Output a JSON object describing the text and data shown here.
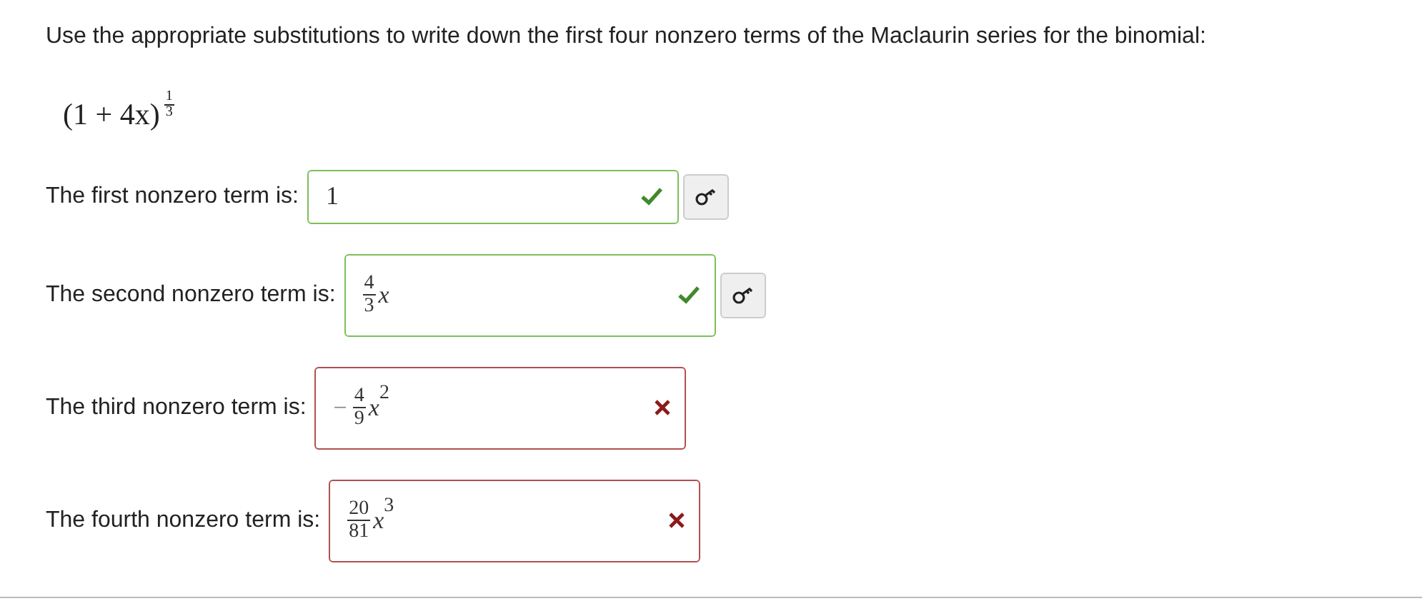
{
  "question": "Use the appropriate substitutions to write down the first four nonzero terms of the Maclaurin series for the binomial:",
  "formula": {
    "base": "(1 + 4x)",
    "exp_numerator": "1",
    "exp_denominator": "3"
  },
  "answers": [
    {
      "label": "The first nonzero term is:",
      "correct": true,
      "show_key_button": true,
      "answer": {
        "kind": "plain",
        "text": "1"
      }
    },
    {
      "label": "The second nonzero term is:",
      "correct": true,
      "show_key_button": true,
      "answer": {
        "kind": "fraction",
        "numerator": "4",
        "denominator": "3",
        "variable": "x"
      }
    },
    {
      "label": "The third nonzero term is:",
      "correct": false,
      "show_key_button": false,
      "answer": {
        "kind": "fraction",
        "sign": "−",
        "numerator": "4",
        "denominator": "9",
        "variable": "x",
        "exponent": "2"
      }
    },
    {
      "label": "The fourth nonzero term is:",
      "correct": false,
      "show_key_button": false,
      "answer": {
        "kind": "fraction",
        "numerator": "20",
        "denominator": "81",
        "variable": "x",
        "exponent": "3"
      }
    }
  ]
}
